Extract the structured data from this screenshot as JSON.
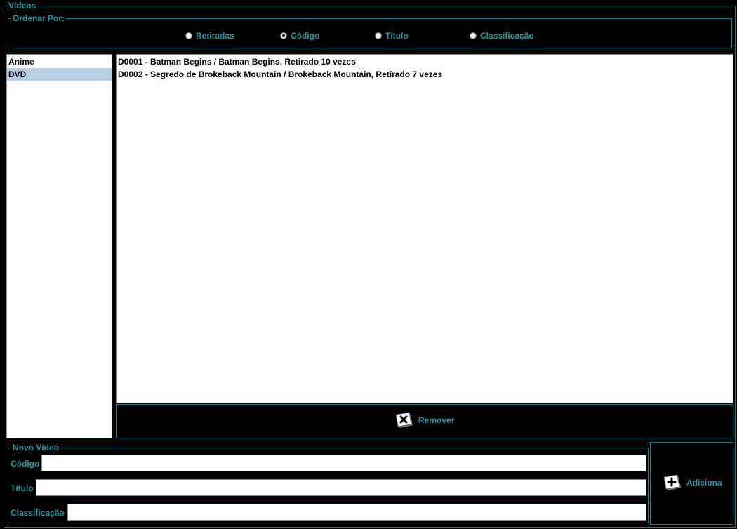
{
  "panel": {
    "title": "Vídeos"
  },
  "sort": {
    "title": "Ordenar Por:",
    "options": [
      {
        "label": "Retiradas",
        "selected": false
      },
      {
        "label": "Código",
        "selected": true
      },
      {
        "label": "Título",
        "selected": false
      },
      {
        "label": "Classificação",
        "selected": false
      }
    ]
  },
  "categories": {
    "items": [
      "Anime",
      "DVD"
    ],
    "selected": "DVD"
  },
  "videos": {
    "items": [
      "D0001 - Batman Begins / Batman Begins, Retirado 10 vezes",
      "D0002 - Segredo de Brokeback Mountain / Brokeback Mountain, Retirado 7 vezes"
    ]
  },
  "actions": {
    "remove_label": "Remover",
    "add_label": "Adiciona"
  },
  "new_video": {
    "title": "Novo Vídeo",
    "code_label": "Código",
    "code_value": "",
    "title_label": "Título",
    "title_value": "",
    "class_label": "Classificação",
    "class_value": ""
  },
  "colors": {
    "accent": "#1f9aa0",
    "border": "#1a7f86",
    "selection": "#b8cfe5"
  }
}
